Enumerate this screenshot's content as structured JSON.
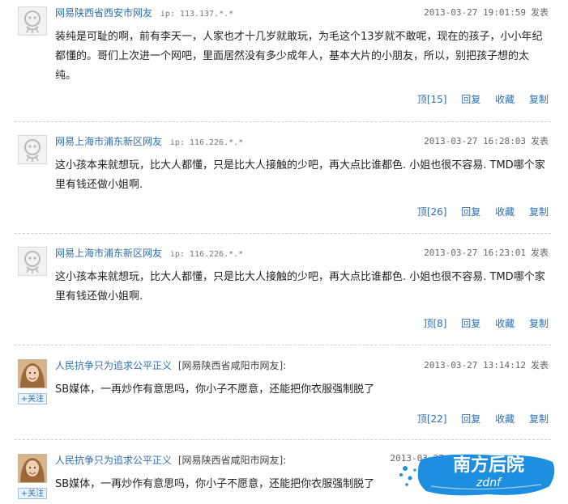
{
  "comments": [
    {
      "author": "网易陕西省西安市网友",
      "ip_label": "ip: 113.137.*.*",
      "location": "",
      "time": "2013-03-27 19:01:59",
      "post_label": "发表",
      "body": "装纯是可耻的啊，前有李天一，人家也才十几岁就敢玩，为毛这个13岁就不敢呢，现在的孩子，小小年纪都懂的。哥们上次进一个网吧，里面居然没有多少成年人，基本大片的小朋友，所以，别把孩子想的太纯。",
      "up_label": "顶",
      "up_count": "[15]",
      "reply": "回复",
      "favorite": "收藏",
      "copy": "复制",
      "avatar": "default-avatar-icon"
    },
    {
      "author": "网易上海市浦东新区网友",
      "ip_label": "ip: 116.226.*.*",
      "location": "",
      "time": "2013-03-27 16:28:03",
      "post_label": "发表",
      "body": "这小孩本来就想玩，比大人都懂，只是比大人接触的少吧，再大点比谁都色. 小姐也很不容易. TMD哪个家里有钱还做小姐啊.",
      "up_label": "顶",
      "up_count": "[26]",
      "reply": "回复",
      "favorite": "收藏",
      "copy": "复制",
      "avatar": "default-avatar-icon"
    },
    {
      "author": "网易上海市浦东新区网友",
      "ip_label": "ip: 116.226.*.*",
      "location": "",
      "time": "2013-03-27 16:23:01",
      "post_label": "发表",
      "body": "这小孩本来就想玩，比大人都懂，只是比大人接触的少吧，再大点比谁都色. 小姐也很不容易. TMD哪个家里有钱还做小姐啊.",
      "up_label": "顶",
      "up_count": "[8]",
      "reply": "回复",
      "favorite": "收藏",
      "copy": "复制",
      "avatar": "default-avatar-icon"
    },
    {
      "author": "人民抗争只为追求公平正义",
      "ip_label": "",
      "location": "[网易陕西省咸阳市网友]:",
      "time": "2013-03-27 13:14:12",
      "post_label": "发表",
      "body": "SB媒体，一再炒作有意思吗，你小子不愿意，还能把你衣服强制脱了",
      "up_label": "顶",
      "up_count": "[22]",
      "reply": "回复",
      "favorite": "收藏",
      "copy": "复制",
      "avatar": "user-photo-avatar",
      "follow_label": "+关注"
    },
    {
      "author": "人民抗争只为追求公平正义",
      "ip_label": "",
      "location": "[网易陕西省咸阳市网友]:",
      "time": "2013-03-27 1",
      "post_label": "",
      "body": "SB媒体，一再炒作有意思吗，你小子不愿意，还能把你衣服强制脱了",
      "avatar": "user-photo-avatar",
      "follow_label": "+关注"
    }
  ],
  "watermark": {
    "title": "南方后院",
    "subtitle": "zdnf"
  },
  "colors": {
    "link": "#2d6fb3",
    "divider": "#cfcfcf",
    "watermark_blue": "#1e8ee0"
  }
}
